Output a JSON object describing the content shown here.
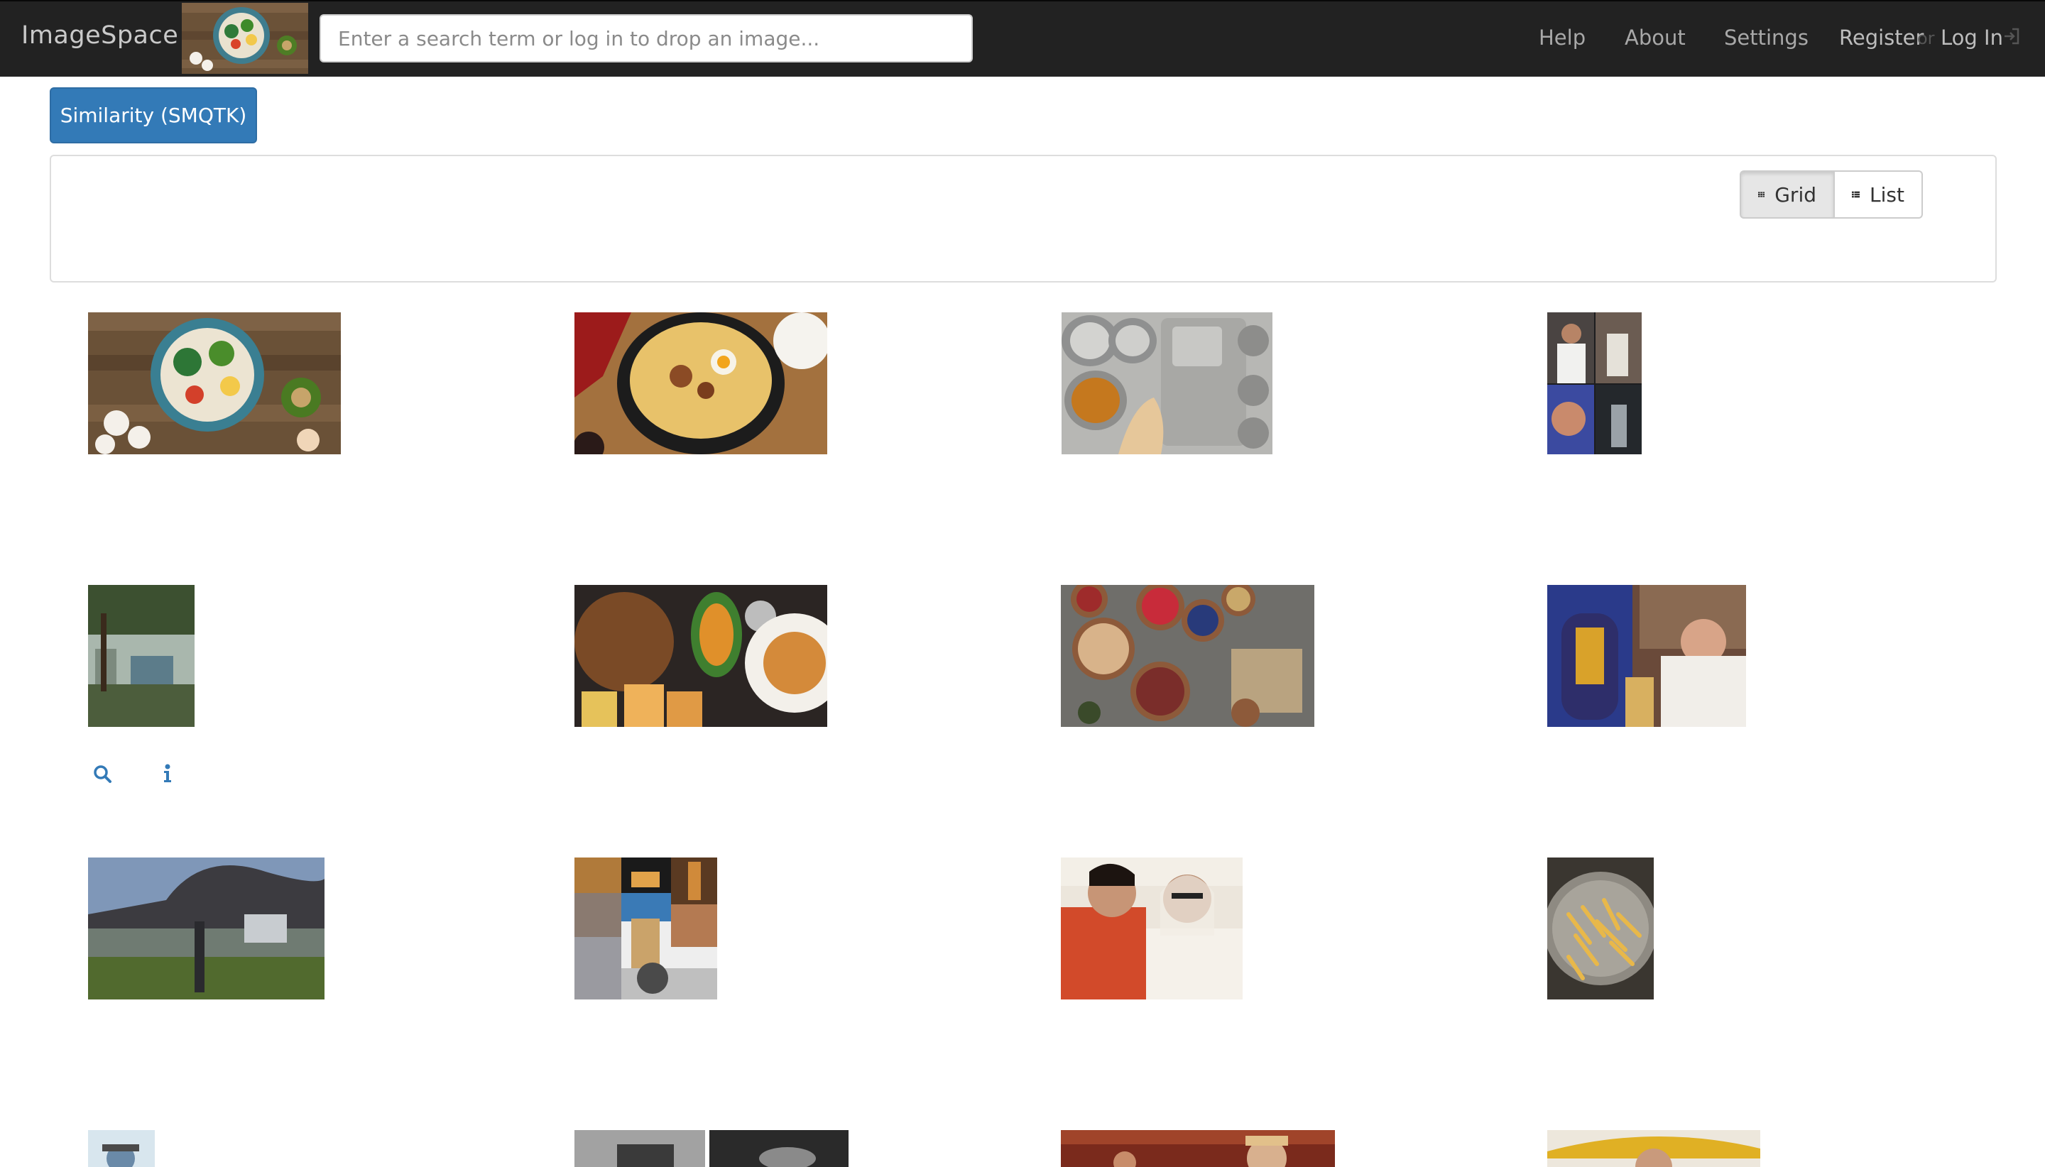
{
  "navbar": {
    "brand": "ImageSpace",
    "search_placeholder": "Enter a search term or log in to drop an image...",
    "links": {
      "help": "Help",
      "about": "About",
      "settings": "Settings",
      "register": "Register",
      "or": "or",
      "login": "Log In"
    },
    "icons": [
      "login-icon"
    ]
  },
  "toolbar": {
    "smqtk_label": "Similarity (SMQTK)"
  },
  "view_toggle": {
    "grid_label": "Grid",
    "list_label": "List",
    "selected": "Grid"
  },
  "result_thumbnails": [
    "food-bowl-salad",
    "biryani-pot",
    "steel-thali-plate",
    "portrait-collage",
    "garden-tree",
    "restaurant-table-food",
    "nuts-fruit-bowls",
    "temple-prayer",
    "city-smoke-landscape",
    "statue-collage",
    "two-women-portrait",
    "fries-on-plate",
    "person-partial",
    "camera-products",
    "man-portrait",
    "hat-portrait"
  ],
  "hover_tools": [
    "search-icon",
    "info-icon"
  ],
  "colors": {
    "navbar": "#222222",
    "primary": "#337ab7",
    "link": "#337ab7"
  }
}
